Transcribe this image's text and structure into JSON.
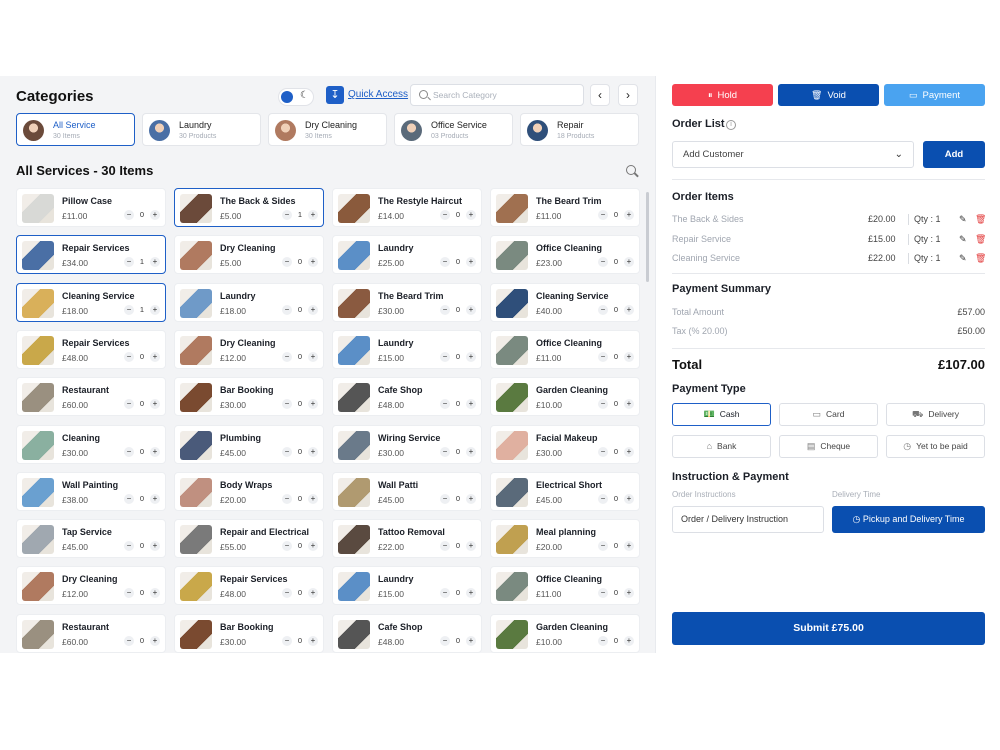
{
  "colors": {
    "primary": "#0a4fb0",
    "accent_blue": "#1e5fc7",
    "hold": "#f5404f",
    "void": "#0a4fb0",
    "payment": "#4aa3f0",
    "delete": "#e23b3b"
  },
  "categories": {
    "title": "Categories",
    "quick_access": "Quick Access",
    "search_placeholder": "Search Category",
    "prev_icon": "chevron-left-icon",
    "next_icon": "chevron-right-icon",
    "items": [
      {
        "name": "All Service",
        "sub": "30 Items",
        "active": true
      },
      {
        "name": "Laundry",
        "sub": "30 Products",
        "active": false
      },
      {
        "name": "Dry Cleaning",
        "sub": "30 Items",
        "active": false
      },
      {
        "name": "Office Service",
        "sub": "03 Products",
        "active": false
      },
      {
        "name": "Repair",
        "sub": "18 Products",
        "active": false
      }
    ]
  },
  "services": {
    "title": "All Services - 30 Items",
    "items": [
      {
        "name": "Pillow Case",
        "price": "£11.00",
        "qty": "0",
        "selected": false,
        "color": "#d8d9d6"
      },
      {
        "name": "The Back & Sides",
        "price": "£5.00",
        "qty": "1",
        "selected": true,
        "color": "#6b4a3a"
      },
      {
        "name": "The Restyle Haircut",
        "price": "£14.00",
        "qty": "0",
        "selected": false,
        "color": "#8a5a3c"
      },
      {
        "name": "The Beard Trim",
        "price": "£11.00",
        "qty": "0",
        "selected": false,
        "color": "#a07050"
      },
      {
        "name": "Repair Services",
        "price": "£34.00",
        "qty": "1",
        "selected": true,
        "color": "#4a6fa5"
      },
      {
        "name": "Dry Cleaning",
        "price": "£5.00",
        "qty": "0",
        "selected": false,
        "color": "#b07a60"
      },
      {
        "name": "Laundry",
        "price": "£25.00",
        "qty": "0",
        "selected": false,
        "color": "#5b8fc7"
      },
      {
        "name": "Office Cleaning",
        "price": "£23.00",
        "qty": "0",
        "selected": false,
        "color": "#7a8a80"
      },
      {
        "name": "Cleaning Service",
        "price": "£18.00",
        "qty": "1",
        "selected": true,
        "color": "#d9b05a"
      },
      {
        "name": "Laundry",
        "price": "£18.00",
        "qty": "0",
        "selected": false,
        "color": "#6f9ac8"
      },
      {
        "name": "The Beard Trim",
        "price": "£30.00",
        "qty": "0",
        "selected": false,
        "color": "#8a5a40"
      },
      {
        "name": "Cleaning Service",
        "price": "£40.00",
        "qty": "0",
        "selected": false,
        "color": "#2f4f7a"
      },
      {
        "name": "Repair Services",
        "price": "£48.00",
        "qty": "0",
        "selected": false,
        "color": "#c9a84a"
      },
      {
        "name": "Dry Cleaning",
        "price": "£12.00",
        "qty": "0",
        "selected": false,
        "color": "#b07a60"
      },
      {
        "name": "Laundry",
        "price": "£15.00",
        "qty": "0",
        "selected": false,
        "color": "#5b8fc7"
      },
      {
        "name": "Office Cleaning",
        "price": "£11.00",
        "qty": "0",
        "selected": false,
        "color": "#7a8a80"
      },
      {
        "name": "Restaurant",
        "price": "£60.00",
        "qty": "0",
        "selected": false,
        "color": "#9a9080"
      },
      {
        "name": "Bar Booking",
        "price": "£30.00",
        "qty": "0",
        "selected": false,
        "color": "#7a4a30"
      },
      {
        "name": "Cafe Shop",
        "price": "£48.00",
        "qty": "0",
        "selected": false,
        "color": "#555555"
      },
      {
        "name": "Garden Cleaning",
        "price": "£10.00",
        "qty": "0",
        "selected": false,
        "color": "#5a7a40"
      },
      {
        "name": "Cleaning",
        "price": "£30.00",
        "qty": "0",
        "selected": false,
        "color": "#8ab0a0"
      },
      {
        "name": "Plumbing",
        "price": "£45.00",
        "qty": "0",
        "selected": false,
        "color": "#4a5a7a"
      },
      {
        "name": "Wiring Service",
        "price": "£30.00",
        "qty": "0",
        "selected": false,
        "color": "#6a7a8a"
      },
      {
        "name": "Facial Makeup",
        "price": "£30.00",
        "qty": "0",
        "selected": false,
        "color": "#e0b0a0"
      },
      {
        "name": "Wall Painting",
        "price": "£38.00",
        "qty": "0",
        "selected": false,
        "color": "#6aa0d0"
      },
      {
        "name": "Body Wraps",
        "price": "£20.00",
        "qty": "0",
        "selected": false,
        "color": "#c09080"
      },
      {
        "name": "Wall Patti",
        "price": "£45.00",
        "qty": "0",
        "selected": false,
        "color": "#b09a70"
      },
      {
        "name": "Electrical Short",
        "price": "£45.00",
        "qty": "0",
        "selected": false,
        "color": "#5a6a7a"
      },
      {
        "name": "Tap Service",
        "price": "£45.00",
        "qty": "0",
        "selected": false,
        "color": "#a0a8b0"
      },
      {
        "name": "Repair and Electrical",
        "price": "£55.00",
        "qty": "0",
        "selected": false,
        "color": "#7a7a7a"
      },
      {
        "name": "Tattoo Removal",
        "price": "£22.00",
        "qty": "0",
        "selected": false,
        "color": "#5a4a40"
      },
      {
        "name": "Meal planning",
        "price": "£20.00",
        "qty": "0",
        "selected": false,
        "color": "#c0a050"
      },
      {
        "name": "Dry Cleaning",
        "price": "£12.00",
        "qty": "0",
        "selected": false,
        "color": "#b07a60"
      },
      {
        "name": "Repair Services",
        "price": "£48.00",
        "qty": "0",
        "selected": false,
        "color": "#c9a84a"
      },
      {
        "name": "Laundry",
        "price": "£15.00",
        "qty": "0",
        "selected": false,
        "color": "#5b8fc7"
      },
      {
        "name": "Office Cleaning",
        "price": "£11.00",
        "qty": "0",
        "selected": false,
        "color": "#7a8a80"
      },
      {
        "name": "Restaurant",
        "price": "£60.00",
        "qty": "0",
        "selected": false,
        "color": "#9a9080"
      },
      {
        "name": "Bar Booking",
        "price": "£30.00",
        "qty": "0",
        "selected": false,
        "color": "#7a4a30"
      },
      {
        "name": "Cafe Shop",
        "price": "£48.00",
        "qty": "0",
        "selected": false,
        "color": "#555555"
      },
      {
        "name": "Garden Cleaning",
        "price": "£10.00",
        "qty": "0",
        "selected": false,
        "color": "#5a7a40"
      }
    ]
  },
  "toolbar": {
    "hold": "Hold",
    "void": "Void",
    "payment": "Payment"
  },
  "order": {
    "title": "Order List",
    "customer_placeholder": "Add Customer",
    "add": "Add",
    "items_title": "Order Items",
    "items": [
      {
        "name": "The Back & Sides",
        "price": "£20.00",
        "qty": "Qty : 1"
      },
      {
        "name": "Repair Service",
        "price": "£15.00",
        "qty": "Qty : 1"
      },
      {
        "name": "Cleaning Service",
        "price": "£22.00",
        "qty": "Qty : 1"
      }
    ]
  },
  "summary": {
    "title": "Payment Summary",
    "total_amount_label": "Total Amount",
    "total_amount": "£57.00",
    "tax_label": "Tax (% 20.00)",
    "tax": "£50.00",
    "total_label": "Total",
    "total": "£107.00"
  },
  "payment_type": {
    "title": "Payment Type",
    "options": [
      {
        "label": "Cash",
        "icon": "cash-icon",
        "active": true
      },
      {
        "label": "Card",
        "icon": "card-icon",
        "active": false
      },
      {
        "label": "Delivery",
        "icon": "delivery-icon",
        "active": false
      },
      {
        "label": "Bank",
        "icon": "bank-icon",
        "active": false
      },
      {
        "label": "Cheque",
        "icon": "cheque-icon",
        "active": false
      },
      {
        "label": "Yet to be paid",
        "icon": "clock-money-icon",
        "active": false
      }
    ]
  },
  "instruction": {
    "title": "Instruction & Payment",
    "order_label": "Order Instructions",
    "delivery_label": "Delivery Time",
    "instruction_placeholder": "Order / Delivery Instruction",
    "pickup": "Pickup and Delivery Time"
  },
  "submit": "Submit  £75.00"
}
